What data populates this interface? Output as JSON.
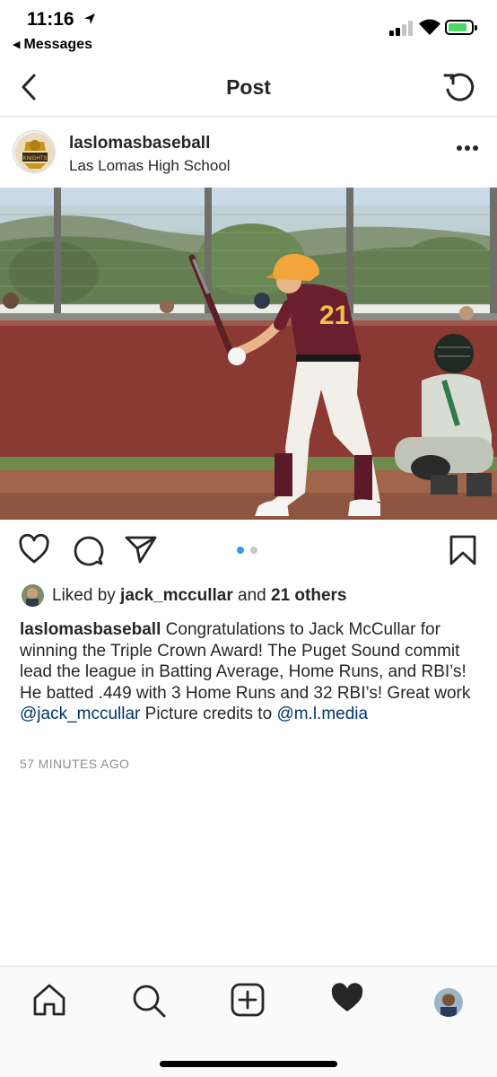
{
  "status_bar": {
    "time": "11:16",
    "back_app": "Messages"
  },
  "nav": {
    "title": "Post"
  },
  "post": {
    "username": "laslomasbaseball",
    "location": "Las Lomas High School",
    "carousel": {
      "total": 2,
      "active": 1
    }
  },
  "likes": {
    "prefix": "Liked by ",
    "user": "jack_mccullar",
    "middle": " and ",
    "others": "21 others"
  },
  "caption": {
    "username": "laslomasbaseball",
    "text1": " Congratulations to Jack McCullar for winning the Triple Crown Award! The Puget Sound commit lead the league in Batting Average, Home Runs, and RBI’s! He batted .449 with 3 Home Runs and 32 RBI’s! Great work ",
    "mention1": "@jack_mccullar",
    "text2": " Picture credits to ",
    "mention2": "@m.l.media"
  },
  "timestamp": "57 MINUTES AGO",
  "colors": {
    "text": "#262626",
    "mention": "#003569",
    "muted": "#8e8e8e",
    "dot_active": "#3897f0",
    "dot_inactive": "#c7c7c7",
    "jersey": "#6b1f2e",
    "helmet": "#f2a53b"
  },
  "icons": {
    "like": "heart-outline-icon",
    "comment": "comment-bubble-icon",
    "share": "paper-plane-icon",
    "save": "bookmark-icon",
    "home": "home-icon",
    "search": "search-icon",
    "add": "plus-square-icon",
    "activity": "heart-filled-icon",
    "profile": "profile-avatar"
  }
}
